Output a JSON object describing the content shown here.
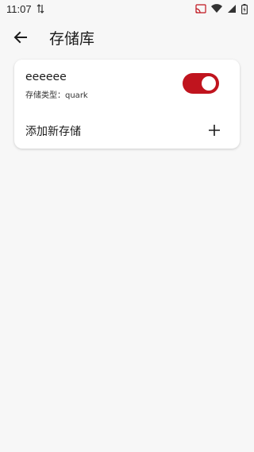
{
  "status_bar": {
    "time": "11:07",
    "icons": [
      "data-transfer-icon",
      "cast-icon",
      "wifi-icon",
      "signal-icon",
      "battery-icon"
    ]
  },
  "app_bar": {
    "title": "存储库",
    "back_icon": "arrow-back-icon"
  },
  "storage_list": {
    "items": [
      {
        "name": "eeeeee",
        "type_line": "存储类型：quark",
        "enabled": true
      }
    ],
    "add_label": "添加新存储",
    "add_icon": "plus-icon"
  },
  "colors": {
    "background": "#f7f7f7",
    "card": "#ffffff",
    "accent": "#c0141e"
  }
}
